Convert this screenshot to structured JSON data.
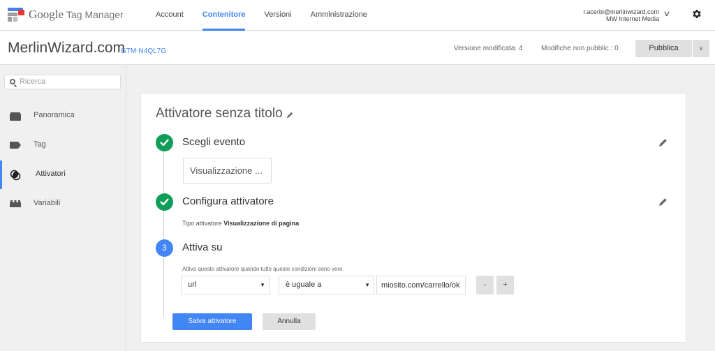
{
  "header": {
    "brand_google": "Google",
    "brand_product": "Tag Manager",
    "nav": [
      {
        "label": "Account",
        "active": false
      },
      {
        "label": "Contenitore",
        "active": true
      },
      {
        "label": "Versioni",
        "active": false
      },
      {
        "label": "Amministrazione",
        "active": false
      }
    ],
    "account_email": "r.acerbi@merlinwizard.com",
    "account_org": "MW Internet Media",
    "account_chevron": "∨",
    "accent_color": "#4285f4"
  },
  "subheader": {
    "container_name": "MerlinWizard.com",
    "container_id": "GTM-N4QL7G",
    "version_modified": "Versione modificata: 4",
    "unpublished": "Modifiche non pubblic.: 0",
    "publish_label": "Pubblica",
    "publish_more": "∨"
  },
  "sidebar": {
    "search_placeholder": "Ricerca",
    "items": [
      {
        "label": "Panoramica",
        "icon": "folder-icon",
        "active": false
      },
      {
        "label": "Tag",
        "icon": "tag-icon",
        "active": false
      },
      {
        "label": "Attivatori",
        "icon": "trigger-icon",
        "active": true
      },
      {
        "label": "Variabili",
        "icon": "variables-icon",
        "active": false
      }
    ]
  },
  "editor": {
    "title": "Attivatore senza titolo",
    "steps": [
      {
        "number": "1",
        "status": "done",
        "title": "Scegli evento"
      },
      {
        "number": "2",
        "status": "done",
        "title": "Configura attivatore"
      },
      {
        "number": "3",
        "status": "current",
        "title": "Attiva su"
      }
    ],
    "event_value": "Visualizzazione ...",
    "trigger_type_label": "Tipo attivatore",
    "trigger_type_value": "Visualizzazione di pagina",
    "condition_hint": "Attiva questo attivatore quando tutte queste condizioni sono vere.",
    "condition": {
      "variable": "url",
      "operator": "è uguale a",
      "value": "miosito.com/carrello/ok"
    },
    "dropdown_arrow": "▼",
    "remove_label": "-",
    "add_label": "+",
    "save_label": "Salva attivatore",
    "cancel_label": "Annulla",
    "done_color": "#0f9d58"
  }
}
